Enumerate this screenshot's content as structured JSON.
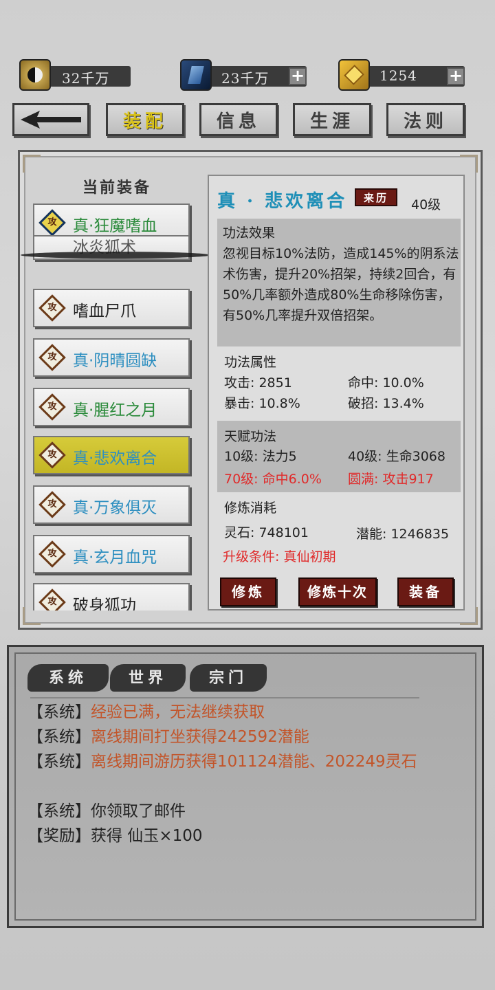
{
  "resources": [
    {
      "icon": "taiji-coin-icon",
      "value": "32千万",
      "plus": false
    },
    {
      "icon": "blue-crystal-icon",
      "value": "23千万",
      "plus": true
    },
    {
      "icon": "gold-ingot-icon",
      "value": "1254",
      "plus": true
    }
  ],
  "tabs": {
    "back_icon": "back-arrow-icon",
    "items": [
      "装配",
      "信息",
      "生涯",
      "法则"
    ],
    "active": "装配"
  },
  "equip": {
    "title": "当前装备",
    "items": [
      {
        "label": "真·狂魔嗜血",
        "badge": "攻",
        "color": "#2a8a3a"
      },
      {
        "label": "冰炎狐术",
        "badge": "攻",
        "color": "#555555"
      },
      {
        "label": "嗜血尸爪",
        "badge": "攻",
        "color": "#222222"
      },
      {
        "label": "真·阴晴圆缺",
        "badge": "攻",
        "color": "#2e8fc0"
      },
      {
        "label": "真·腥红之月",
        "badge": "攻",
        "color": "#2a8a3a"
      },
      {
        "label": "真·悲欢离合",
        "badge": "攻",
        "color": "#2e8fc0",
        "selected": true
      },
      {
        "label": "真·万象俱灭",
        "badge": "攻",
        "color": "#2e8fc0"
      },
      {
        "label": "真·玄月血咒",
        "badge": "攻",
        "color": "#2e8fc0"
      },
      {
        "label": "破身狐功",
        "badge": "攻",
        "color": "#222222"
      }
    ]
  },
  "detail": {
    "name": "真 · 悲欢离合",
    "origin_button": "来历",
    "level": "40级",
    "effect_title": "功法效果",
    "effect_text": "忽视目标10%法防，造成145%的阴系法术伤害，提升20%招架，持续2回合，有50%几率额外造成80%生命移除伤害，有50%几率提升双倍招架。",
    "attr_title": "功法属性",
    "attrs": [
      "攻击: 2851",
      "命中: 10.0%",
      "暴击: 10.8%",
      "破招: 13.4%"
    ],
    "talent_title": "天赋功法",
    "talents": [
      "10级: 法力5",
      "40级: 生命3068",
      "70级: 命中6.0%",
      "圆满: 攻击917"
    ],
    "cost_title": "修炼消耗",
    "cost_stone": "灵石: 748101",
    "cost_potential": "潜能: 1246835",
    "upgrade": "升级条件: 真仙初期",
    "buttons": [
      "修炼",
      "修炼十次",
      "装备"
    ]
  },
  "chat": {
    "tabs": [
      "系统",
      "世界",
      "宗门"
    ],
    "messages": [
      {
        "tag": "【系统】",
        "text": "经验已满，无法继续获取",
        "highlight": true
      },
      {
        "tag": "【系统】",
        "text": "离线期间打坐获得242592潜能",
        "highlight": true
      },
      {
        "tag": "【系统】",
        "text": "离线期间游历获得101124潜能、202249灵石",
        "highlight": true
      },
      {
        "tag": "【系统】",
        "text": "你领取了邮件",
        "highlight": false
      },
      {
        "tag": "【奖励】",
        "text": "获得 仙玉×100",
        "highlight": false
      }
    ]
  }
}
